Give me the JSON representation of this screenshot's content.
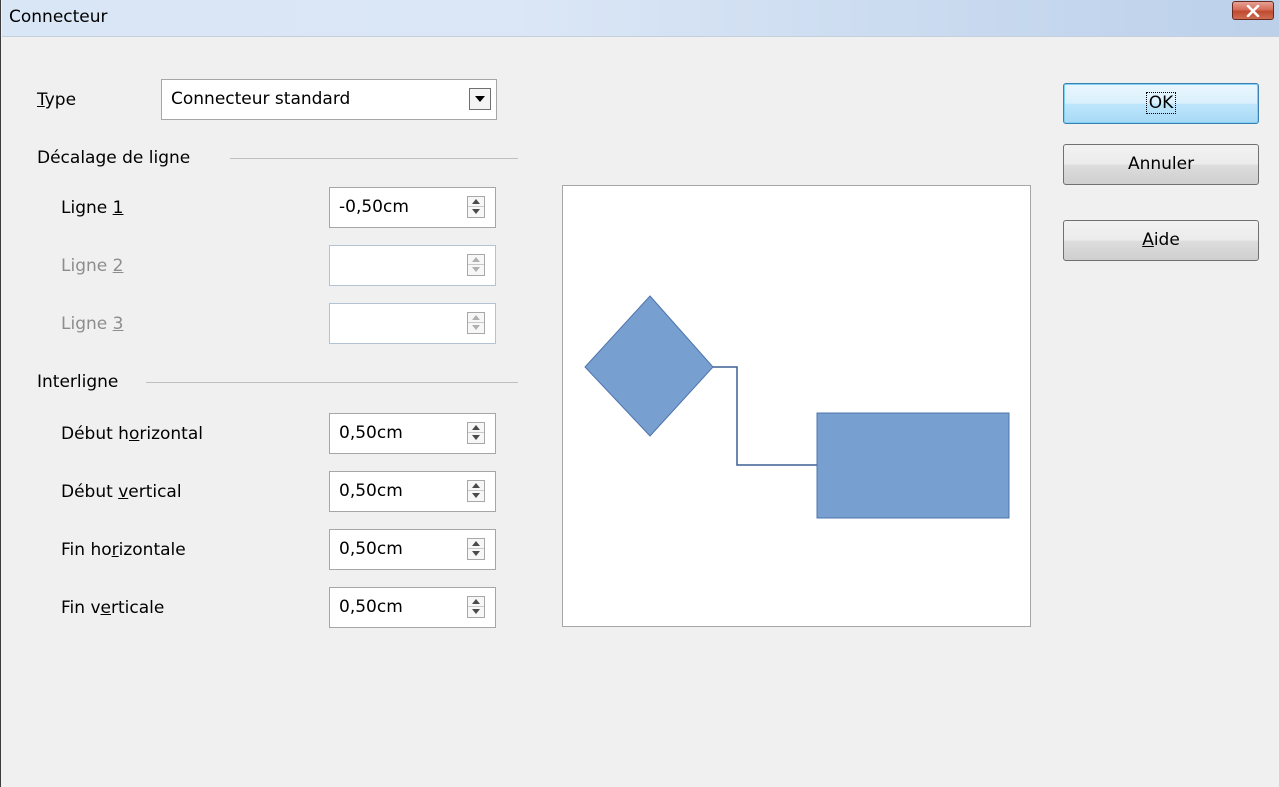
{
  "window": {
    "title": "Connecteur"
  },
  "type_field": {
    "label_prefix": "",
    "label_underlined": "T",
    "label_rest": "ype",
    "selected": "Connecteur standard"
  },
  "line_offset": {
    "heading": "Décalage de ligne",
    "rows": [
      {
        "label_before": "Ligne ",
        "label_underlined": "1",
        "label_after": "",
        "value": "-0,50cm",
        "enabled": true
      },
      {
        "label_before": "Ligne ",
        "label_underlined": "2",
        "label_after": "",
        "value": "",
        "enabled": false
      },
      {
        "label_before": "Ligne ",
        "label_underlined": "3",
        "label_after": "",
        "value": "",
        "enabled": false
      }
    ]
  },
  "spacing": {
    "heading": "Interligne",
    "rows": [
      {
        "label_before": "Début h",
        "label_underlined": "o",
        "label_after": "rizontal",
        "value": "0,50cm"
      },
      {
        "label_before": "Début ",
        "label_underlined": "v",
        "label_after": "ertical",
        "value": "0,50cm"
      },
      {
        "label_before": "Fin ho",
        "label_underlined": "r",
        "label_after": "izontale",
        "value": "0,50cm"
      },
      {
        "label_before": "Fin v",
        "label_underlined": "e",
        "label_after": "rticale",
        "value": "0,50cm"
      }
    ]
  },
  "buttons": {
    "ok": "OK",
    "cancel": "Annuler",
    "help_underlined": "A",
    "help_rest": "ide"
  },
  "colors": {
    "shape_fill": "#779fd0",
    "shape_stroke": "#4f74ad",
    "connector": "#3d5f94"
  }
}
